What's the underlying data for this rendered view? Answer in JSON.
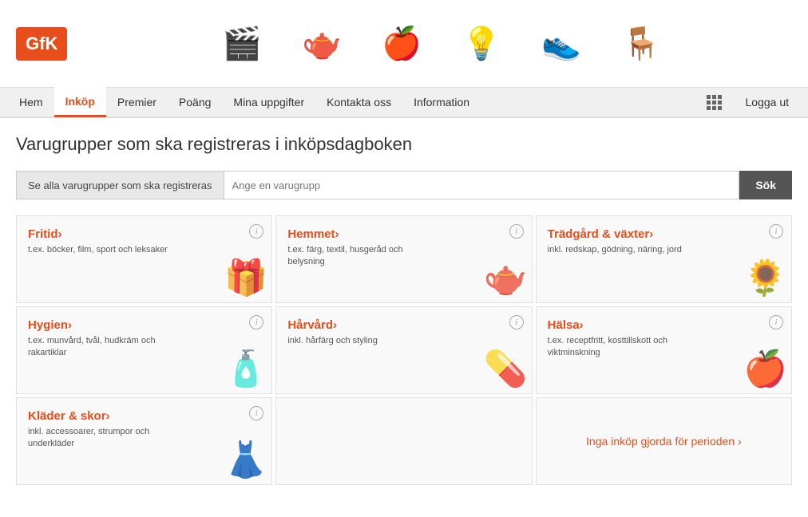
{
  "brand": {
    "logo": "GfK"
  },
  "header": {
    "icons": [
      "🎬",
      "🫖",
      "🍎",
      "💡",
      "👟",
      "🪑"
    ]
  },
  "nav": {
    "items": [
      {
        "label": "Hem",
        "active": false
      },
      {
        "label": "Inköp",
        "active": true
      },
      {
        "label": "Premier",
        "active": false
      },
      {
        "label": "Poäng",
        "active": false
      },
      {
        "label": "Mina uppgifter",
        "active": false
      },
      {
        "label": "Kontakta oss",
        "active": false
      },
      {
        "label": "Information",
        "active": false
      }
    ],
    "logout_label": "Logga ut"
  },
  "page": {
    "title": "Varugrupper som ska registreras i inköpsdagboken"
  },
  "search": {
    "label": "Se alla varugrupper som ska registreras",
    "placeholder": "Ange en varugrupp",
    "button": "Sök"
  },
  "categories": [
    {
      "title": "Fritid›",
      "desc": "t.ex. böcker, film, sport och leksaker",
      "icon": "🎁"
    },
    {
      "title": "Hemmet›",
      "desc": "t.ex. färg, textil, husgeråd och belysning",
      "icon": "🫖"
    },
    {
      "title": "Trädgård & växter›",
      "desc": "inkl. redskap, gödning, näring, jord",
      "icon": "🌻"
    },
    {
      "title": "Hygien›",
      "desc": "t.ex. munvård, tvål, hudkräm och rakartiklar",
      "icon": "🧴"
    },
    {
      "title": "Hårvård›",
      "desc": "inkl. hårfärg och styling",
      "icon": "💊"
    },
    {
      "title": "Hälsa›",
      "desc": "t.ex. receptfritt, kosttillskott och viktminskning",
      "icon": "🍎"
    },
    {
      "title": "Kläder & skor›",
      "desc": "inkl. accessoarer, strumpor och underkläder",
      "icon": "👗"
    },
    {
      "empty": true
    },
    {
      "link": "Inga inköp gjorda för perioden ›"
    }
  ]
}
